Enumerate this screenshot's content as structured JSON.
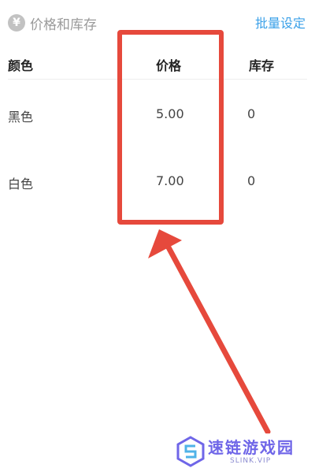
{
  "section": {
    "icon": "yen-icon",
    "icon_glyph": "¥",
    "title": "价格和库存",
    "action_label": "批量设定"
  },
  "table": {
    "columns": [
      "颜色",
      "价格",
      "库存"
    ],
    "rows": [
      {
        "color": "黑色",
        "price": "5.00",
        "stock": "0"
      },
      {
        "color": "白色",
        "price": "7.00",
        "stock": "0"
      }
    ]
  },
  "annotation": {
    "highlight_color": "#e6493c"
  },
  "watermark": {
    "brand": "速链游戏园",
    "sub": "SLINK.VIP"
  },
  "colors": {
    "accent": "#3aa0e8",
    "muted": "#9a9a9a"
  }
}
